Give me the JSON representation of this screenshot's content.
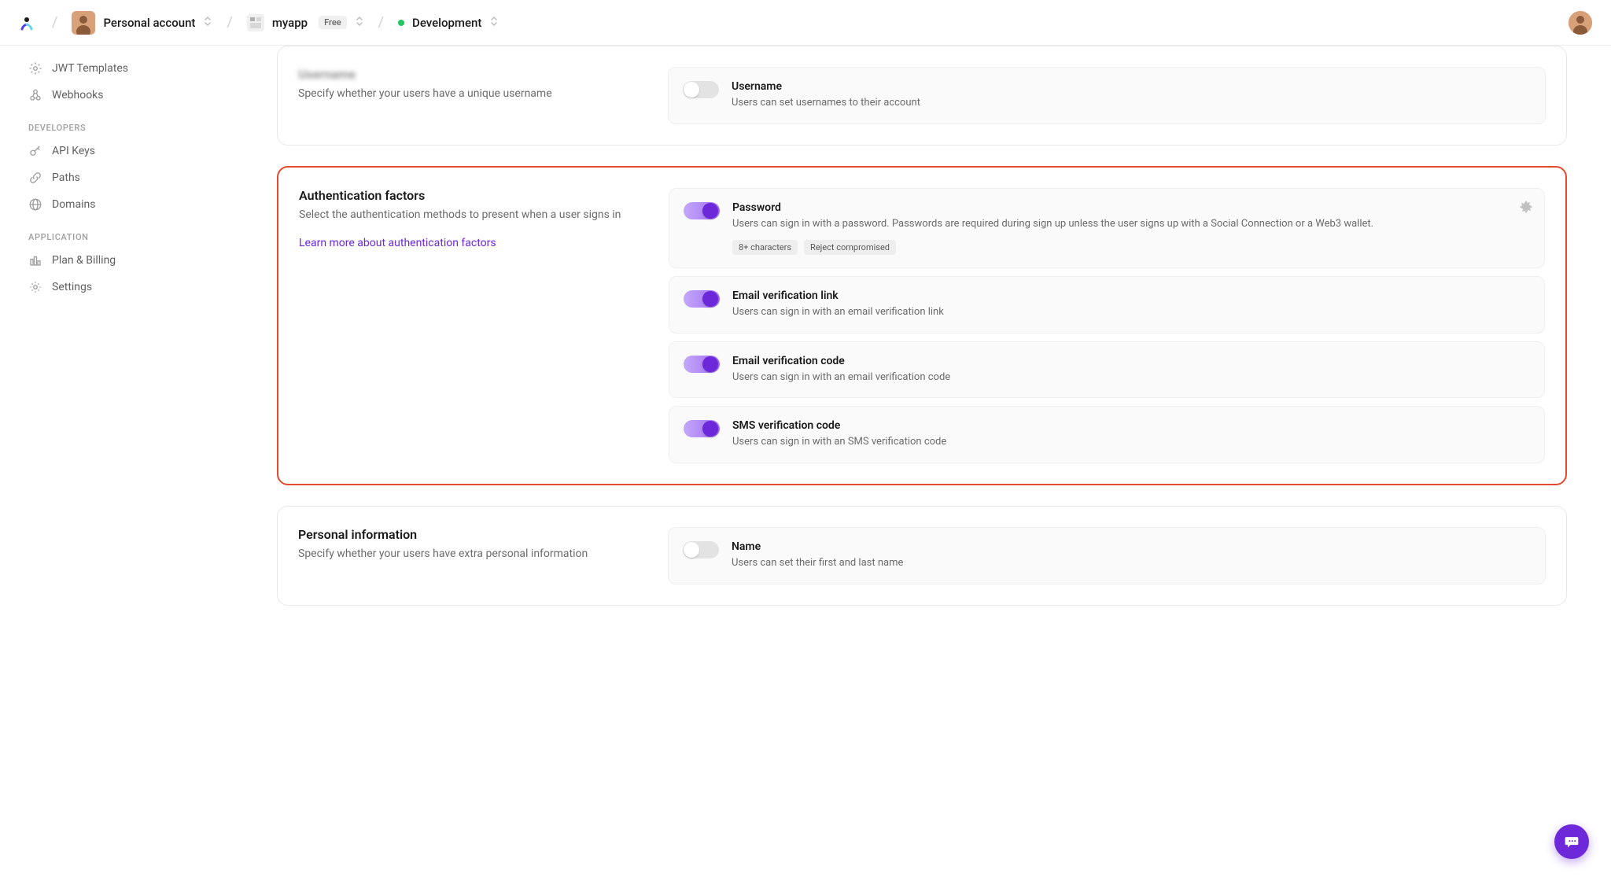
{
  "breadcrumbs": {
    "account": "Personal account",
    "app": "myapp",
    "app_badge": "Free",
    "env": "Development"
  },
  "sidebar": {
    "top_items": [
      {
        "icon": "gear-star",
        "label": "JWT Templates"
      },
      {
        "icon": "webhooks",
        "label": "Webhooks"
      }
    ],
    "groups": [
      {
        "label": "DEVELOPERS",
        "items": [
          {
            "icon": "key",
            "label": "API Keys"
          },
          {
            "icon": "link",
            "label": "Paths"
          },
          {
            "icon": "globe",
            "label": "Domains"
          }
        ]
      },
      {
        "label": "APPLICATION",
        "items": [
          {
            "icon": "columns",
            "label": "Plan & Billing"
          },
          {
            "icon": "gear",
            "label": "Settings"
          }
        ]
      }
    ]
  },
  "sections": {
    "username": {
      "title": "Username",
      "desc": "Specify whether your users have a unique username",
      "options": [
        {
          "enabled": false,
          "title": "Username",
          "desc": "Users can set usernames to their account"
        }
      ]
    },
    "auth": {
      "title": "Authentication factors",
      "desc": "Select the authentication methods to present when a user signs in",
      "link": "Learn more about authentication factors",
      "options": [
        {
          "enabled": true,
          "title": "Password",
          "desc": "Users can sign in with a password. Passwords are required during sign up unless the user signs up with a Social Connection or a Web3 wallet.",
          "tags": [
            "8+ characters",
            "Reject compromised"
          ],
          "gear": true
        },
        {
          "enabled": true,
          "title": "Email verification link",
          "desc": "Users can sign in with an email verification link"
        },
        {
          "enabled": true,
          "title": "Email verification code",
          "desc": "Users can sign in with an email verification code"
        },
        {
          "enabled": true,
          "title": "SMS verification code",
          "desc": "Users can sign in with an SMS verification code"
        }
      ]
    },
    "personal": {
      "title": "Personal information",
      "desc": "Specify whether your users have extra personal information",
      "options": [
        {
          "enabled": false,
          "title": "Name",
          "desc": "Users can set their first and last name"
        }
      ]
    }
  }
}
